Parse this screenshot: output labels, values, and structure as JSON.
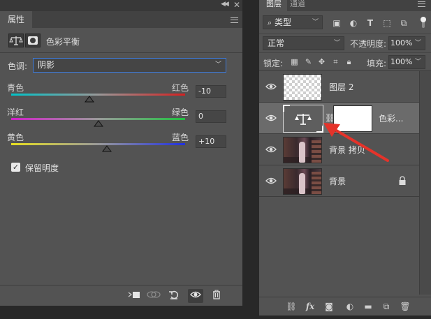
{
  "properties_panel": {
    "tab_label": "属性",
    "title": "色彩平衡",
    "tone_label": "色调:",
    "tone_value": "阴影",
    "sliders": [
      {
        "left_label": "青色",
        "right_label": "红色",
        "value": "-10",
        "level": -10,
        "gradient": [
          "#00c2c8",
          "#d42020"
        ]
      },
      {
        "left_label": "洋红",
        "right_label": "绿色",
        "value": "0",
        "level": 0,
        "gradient": [
          "#d020c8",
          "#20c040"
        ]
      },
      {
        "left_label": "黄色",
        "right_label": "蓝色",
        "value": "+10",
        "level": 10,
        "gradient": [
          "#e8e020",
          "#2030e0"
        ]
      }
    ],
    "preserve_label": "保留明度",
    "preserve_checked": true
  },
  "layers_panel": {
    "tabs": [
      "图层",
      "通道"
    ],
    "filter_value": "类型",
    "blend_mode": "正常",
    "opacity_label": "不透明度:",
    "opacity_value": "100%",
    "lock_label": "锁定:",
    "fill_label": "填充:",
    "fill_value": "100%",
    "layers": [
      {
        "name": "图层 2",
        "kind": "transparent",
        "selected": false,
        "locked": false
      },
      {
        "name": "色彩...",
        "kind": "adjustment",
        "selected": true,
        "locked": false
      },
      {
        "name": "背景 拷贝",
        "kind": "photo",
        "selected": false,
        "locked": false
      },
      {
        "name": "背景",
        "kind": "photo",
        "selected": false,
        "locked": true
      }
    ]
  },
  "colors": {
    "panel_bg": "#535353",
    "dark_bg": "#282828",
    "selected_layer": "#6b6b6b",
    "focus_border": "#3d7ad8",
    "annotation_arrow": "#e5332a"
  }
}
